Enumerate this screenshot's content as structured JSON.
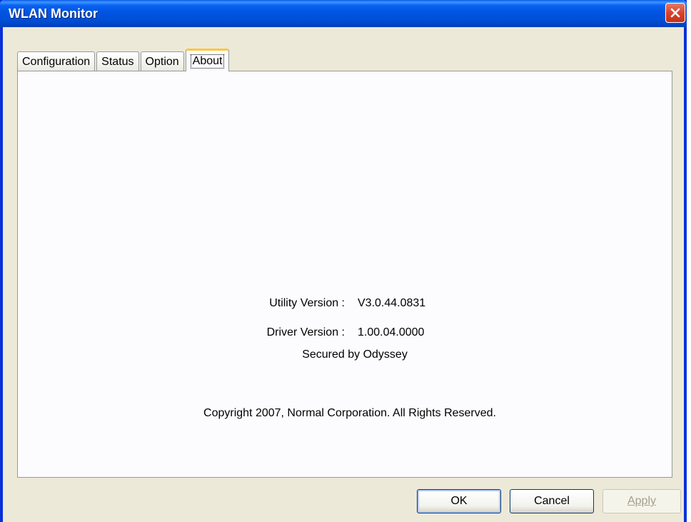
{
  "window": {
    "title": "WLAN Monitor"
  },
  "tabs": [
    {
      "label": "Configuration",
      "active": false
    },
    {
      "label": "Status",
      "active": false
    },
    {
      "label": "Option",
      "active": false
    },
    {
      "label": "About",
      "active": true
    }
  ],
  "about": {
    "utility_label": "Utility Version :",
    "utility_value": "V3.0.44.0831",
    "driver_label": "Driver Version :",
    "driver_value": "1.00.04.0000",
    "secured": "Secured by Odyssey",
    "copyright": "Copyright 2007, Normal Corporation. All Rights Reserved."
  },
  "buttons": {
    "ok": "OK",
    "cancel": "Cancel",
    "apply": "Apply"
  },
  "icons": {
    "close": "close-icon"
  },
  "colors": {
    "titlebar": "#0054e3",
    "window_face": "#ece9d8",
    "active_tab_highlight": "#ffc83c",
    "close_button": "#d8432c"
  }
}
